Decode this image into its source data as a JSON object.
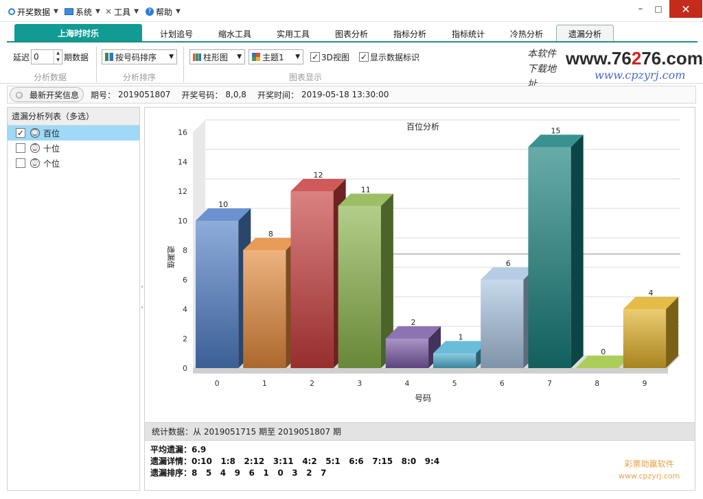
{
  "menu": {
    "items": [
      {
        "label": "开奖数据",
        "icon": "circle-icon"
      },
      {
        "label": "系统",
        "icon": "monitor-icon"
      },
      {
        "label": "工具",
        "icon": "tools-icon"
      },
      {
        "label": "帮助",
        "icon": "help-icon"
      }
    ],
    "window": {
      "minimize": "–",
      "maximize": "□",
      "close": "✕"
    }
  },
  "tabs": {
    "lottery": "上海时时乐",
    "items": [
      "计划追号",
      "缩水工具",
      "实用工具",
      "图表分析",
      "指标分析",
      "指标统计",
      "冷热分析"
    ],
    "active": "遗漏分析"
  },
  "toolbar": {
    "delay_label": "延迟",
    "delay_value": "0",
    "periods_label": "期数据",
    "group1_label": "分析数据",
    "sort_value": "按号码排序",
    "group2_label": "分析排序",
    "chart_type_value": "柱形图",
    "theme_value": "主题1",
    "view3d_label": "3D视图",
    "view3d_checked": "✓",
    "show_labels_label": "显示数据标识",
    "show_labels_checked": "✓",
    "group3_label": "图表显示"
  },
  "logo": {
    "hand_text": "本软件 下载地址",
    "big_pre": "www.76",
    "big_red": "2",
    "big_post": "76.com",
    "small": "www.cpzyrj.com"
  },
  "info": {
    "title": "最新开奖信息",
    "issue_label": "期号：",
    "issue": "2019051807",
    "numbers_label": "开奖号码：",
    "numbers": "8,0,8",
    "time_label": "开奖时间：",
    "time": "2019-05-18 13:30:00"
  },
  "left": {
    "header": "遗漏分析列表（多选）",
    "items": [
      {
        "label": "百位",
        "checked": "✓",
        "selected": true
      },
      {
        "label": "十位",
        "checked": "",
        "selected": false
      },
      {
        "label": "个位",
        "checked": "",
        "selected": false
      }
    ]
  },
  "chart_data": {
    "type": "bar",
    "title": "百位分析",
    "xlabel": "号码",
    "ylabel": "遗漏值",
    "categories": [
      "0",
      "1",
      "2",
      "3",
      "4",
      "5",
      "6",
      "7",
      "8",
      "9"
    ],
    "values": [
      10,
      8,
      12,
      11,
      2,
      1,
      6,
      15,
      0,
      4
    ],
    "ylim": [
      0,
      16
    ],
    "yticks": [
      0,
      2,
      4,
      6,
      8,
      10,
      12,
      14,
      16
    ],
    "reference_line": 6.9,
    "colors": [
      "#4f7fc6",
      "#e48a3a",
      "#c83d3d",
      "#8bb44a",
      "#7a5aa6",
      "#4fb1d1",
      "#a9c4e0",
      "#167f7c",
      "#9cc43c",
      "#e0b028"
    ],
    "view3d": true,
    "data_labels": true,
    "grid": true
  },
  "stats": {
    "header": "统计数据：从 2019051715 期至 2019051807 期",
    "avg_label": "平均遗漏：",
    "avg_value": "6.9",
    "detail_label": "遗漏详情：",
    "detail_value": "0:10   1:8   2:12   3:11   4:2   5:1   6:6   7:15   8:0   9:4",
    "rank_label": "遗漏排序：",
    "rank_value": "8   5   4   9   6   1   0   3   2   7",
    "watermark_name": "彩票助赢软件",
    "watermark_url": "www.cpzyrj.com"
  }
}
